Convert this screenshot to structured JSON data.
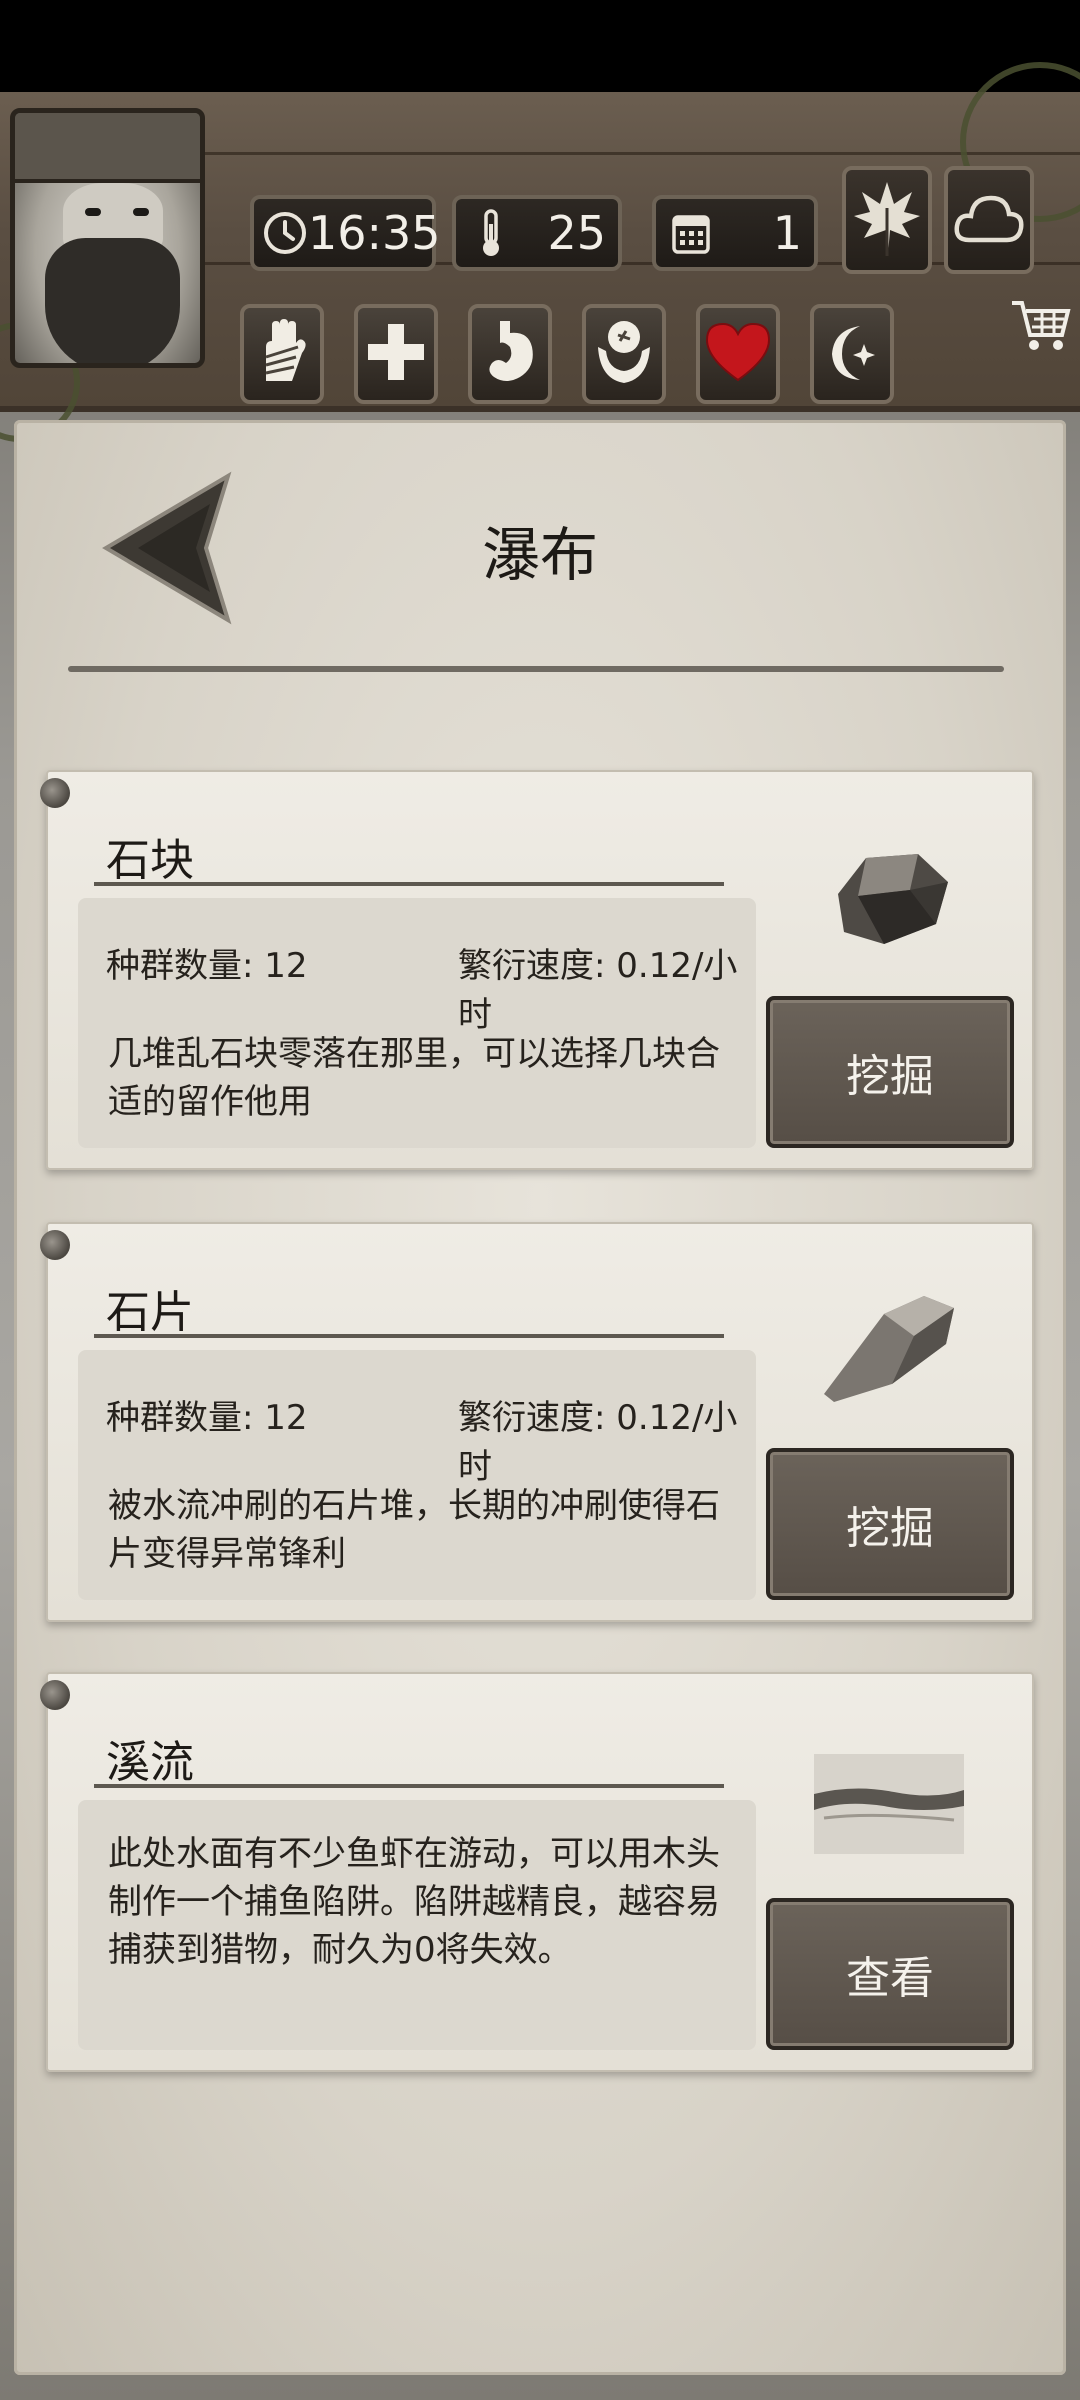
{
  "hud": {
    "time": "16:35",
    "temperature": "25",
    "day": "1"
  },
  "header": {
    "title": "瀑布"
  },
  "resources": [
    {
      "name": "石块",
      "population_label": "种群数量: 12",
      "growth_label": "繁衍速度: 0.12/小时",
      "description": "几堆乱石块零落在那里，可以选择几块合适的留作他用",
      "action": "挖掘",
      "icon": "rock-icon"
    },
    {
      "name": "石片",
      "population_label": "种群数量: 12",
      "growth_label": "繁衍速度: 0.12/小时",
      "description": "被水流冲刷的石片堆，长期的冲刷使得石片变得异常锋利",
      "action": "挖掘",
      "icon": "stone-flake-icon"
    },
    {
      "name": "溪流",
      "description": "此处水面有不少鱼虾在游动，可以用木头制作一个捕鱼陷阱。陷阱越精良，越容易捕获到猎物，耐久为0将失效。",
      "action": "查看",
      "icon": "stream-icon"
    }
  ],
  "colors": {
    "heart": "#c4161c",
    "panel": "#e2ded5",
    "button": "#5f574f"
  }
}
